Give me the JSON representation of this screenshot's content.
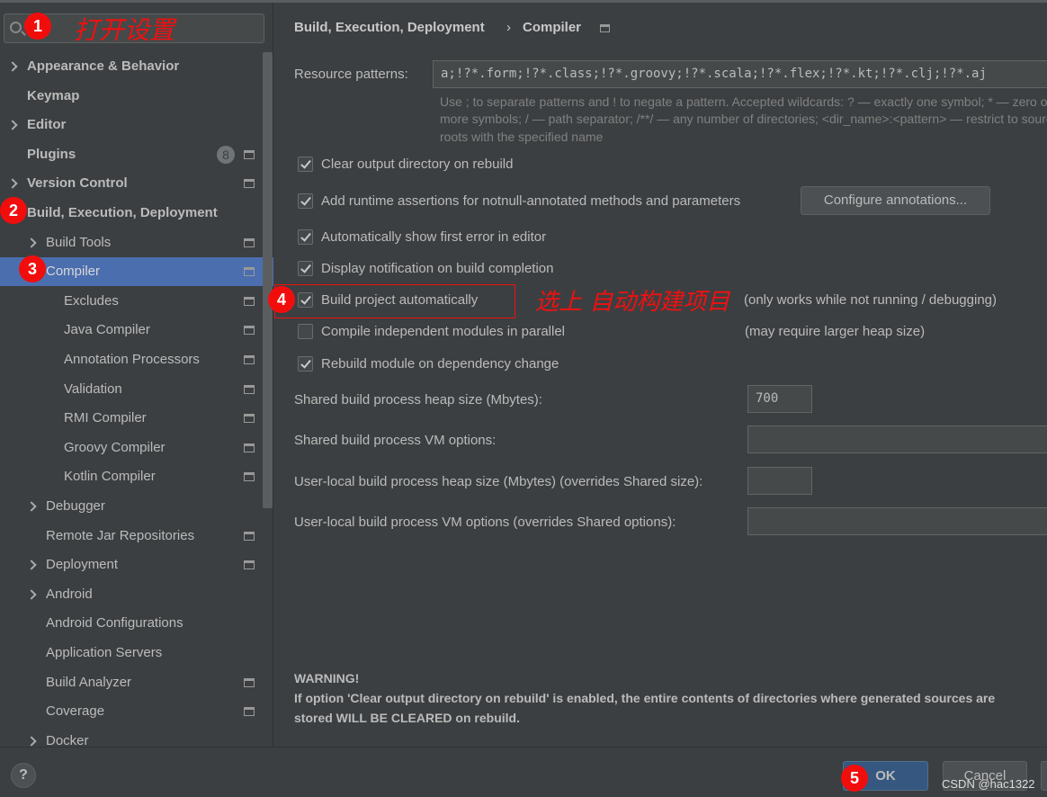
{
  "search": {
    "placeholder": "",
    "annotation": "打开设置"
  },
  "sidebar": {
    "items": [
      {
        "label": "Appearance & Behavior",
        "bold": true,
        "chevron": true,
        "level": 0
      },
      {
        "label": "Keymap",
        "bold": true,
        "level": 0
      },
      {
        "label": "Editor",
        "bold": true,
        "chevron": true,
        "level": 0
      },
      {
        "label": "Plugins",
        "bold": true,
        "level": 0,
        "badge": "8",
        "page": true
      },
      {
        "label": "Version Control",
        "bold": true,
        "chevron": true,
        "level": 0,
        "page": true
      },
      {
        "label": "Build, Execution, Deployment",
        "bold": true,
        "level": 0
      },
      {
        "label": "Build Tools",
        "chevron": true,
        "level": 1,
        "page": true
      },
      {
        "label": "Compiler",
        "level": 1,
        "page": true,
        "selected": true
      },
      {
        "label": "Excludes",
        "level": 2,
        "page": true
      },
      {
        "label": "Java Compiler",
        "level": 2,
        "page": true
      },
      {
        "label": "Annotation Processors",
        "level": 2,
        "page": true
      },
      {
        "label": "Validation",
        "level": 2,
        "page": true
      },
      {
        "label": "RMI Compiler",
        "level": 2,
        "page": true
      },
      {
        "label": "Groovy Compiler",
        "level": 2,
        "page": true
      },
      {
        "label": "Kotlin Compiler",
        "level": 2,
        "page": true
      },
      {
        "label": "Debugger",
        "chevron": true,
        "level": 1
      },
      {
        "label": "Remote Jar Repositories",
        "level": 1,
        "page": true
      },
      {
        "label": "Deployment",
        "chevron": true,
        "level": 1,
        "page": true
      },
      {
        "label": "Android",
        "chevron": true,
        "level": 1
      },
      {
        "label": "Android Configurations",
        "level": 1
      },
      {
        "label": "Application Servers",
        "level": 1
      },
      {
        "label": "Build Analyzer",
        "level": 1,
        "page": true
      },
      {
        "label": "Coverage",
        "level": 1,
        "page": true
      },
      {
        "label": "Docker",
        "chevron": true,
        "level": 1
      }
    ]
  },
  "markers": [
    "1",
    "2",
    "3",
    "4",
    "5"
  ],
  "main": {
    "breadcrumb": [
      "Build, Execution, Deployment",
      "Compiler"
    ],
    "resource_label": "Resource patterns:",
    "resource_value": "a;!?*.form;!?*.class;!?*.groovy;!?*.scala;!?*.flex;!?*.kt;!?*.clj;!?*.aj",
    "hint": [
      "Use ; to separate patterns and ! to negate a pattern. Accepted wildcards: ? — exactly one symbol; * — zero or",
      "more symbols; / — path separator; /**/ — any number of directories;  <dir_name>:<pattern> — restrict to source",
      "roots with the specified name"
    ],
    "checkboxes": [
      {
        "label": "Clear output directory on rebuild",
        "checked": true
      },
      {
        "label": "Add runtime assertions for notnull-annotated methods and parameters",
        "checked": true
      },
      {
        "label": "Automatically show first error in editor",
        "checked": true
      },
      {
        "label": "Display notification on build completion",
        "checked": true
      },
      {
        "label": "Build project automatically",
        "checked": true
      },
      {
        "label": "Compile independent modules in parallel",
        "checked": false
      },
      {
        "label": "Rebuild module on dependency change",
        "checked": true
      }
    ],
    "configure_button": "Configure annotations...",
    "note_auto": "(only works while not running / debugging)",
    "note_parallel": "(may require larger heap size)",
    "annotation_auto": "选上 自动构建项目",
    "fields": [
      {
        "label": "Shared build process heap size (Mbytes):",
        "value": "700"
      },
      {
        "label": "Shared build process VM options:",
        "value": ""
      },
      {
        "label": "User-local build process heap size (Mbytes) (overrides Shared size):",
        "value": ""
      },
      {
        "label": "User-local build process VM options (overrides Shared options):",
        "value": ""
      }
    ],
    "warning_title": "WARNING!",
    "warning_lines": [
      "If option 'Clear output directory on rebuild' is enabled, the entire contents of directories where generated sources are",
      "stored WILL BE CLEARED on rebuild."
    ]
  },
  "footer": {
    "help": "?",
    "ok": "OK",
    "cancel": "Cancel",
    "watermark": "CSDN @hac1322"
  },
  "colors": {
    "selection": "#4b6eaf",
    "annotation": "#f20d0d",
    "background": "#3c3f41"
  }
}
